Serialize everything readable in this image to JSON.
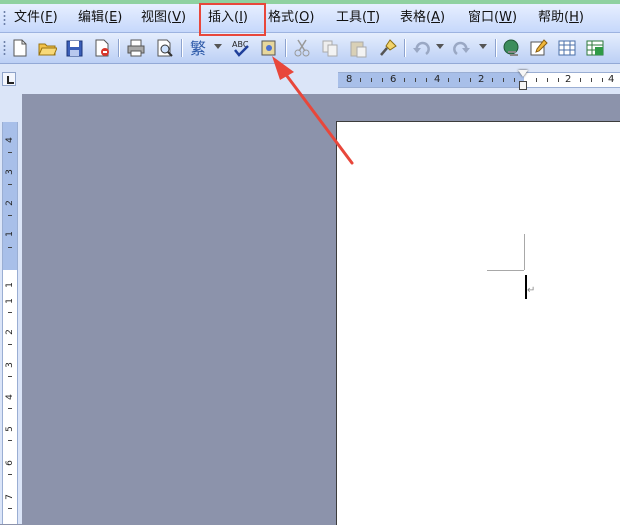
{
  "menubar": {
    "items": [
      {
        "name": "file",
        "label": "文件(",
        "key": "F",
        "end": ")"
      },
      {
        "name": "edit",
        "label": "编辑(",
        "key": "E",
        "end": ")"
      },
      {
        "name": "view",
        "label": "视图(",
        "key": "V",
        "end": ")"
      },
      {
        "name": "insert",
        "label": "插入(",
        "key": "I",
        "end": ")"
      },
      {
        "name": "format",
        "label": "格式(",
        "key": "O",
        "end": ")"
      },
      {
        "name": "tools",
        "label": "工具(",
        "key": "T",
        "end": ")"
      },
      {
        "name": "table",
        "label": "表格(",
        "key": "A",
        "end": ")"
      },
      {
        "name": "window",
        "label": "窗口(",
        "key": "W",
        "end": ")"
      },
      {
        "name": "help",
        "label": "帮助(",
        "key": "H",
        "end": ")"
      }
    ]
  },
  "toolbar": {
    "icons": [
      "new-document-icon",
      "open-folder-icon",
      "save-icon",
      "permission-icon",
      "print-icon",
      "print-preview-icon",
      "research-icon",
      "spelling-icon",
      "cut-icon",
      "copy-icon",
      "paste-icon",
      "format-painter-icon",
      "undo-icon",
      "redo-icon",
      "hyperlink-icon",
      "tables-borders-icon",
      "insert-table-icon",
      "insert-excel-icon"
    ]
  },
  "ruler": {
    "h_labels": [
      "8",
      "6",
      "4",
      "2",
      "2",
      "4"
    ],
    "v_labels": [
      "4",
      "3",
      "2",
      "1",
      "1",
      "1",
      "2",
      "3",
      "4",
      "5",
      "6",
      "7"
    ]
  },
  "document": {
    "paragraph_mark": "↵"
  },
  "annotation": {
    "color": "#e8473b"
  }
}
